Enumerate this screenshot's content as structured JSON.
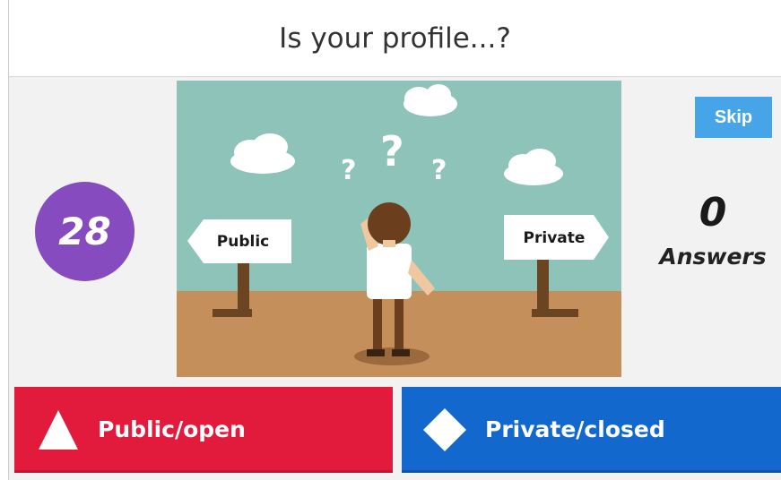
{
  "question": {
    "title": "Is your profile...?"
  },
  "timer": {
    "value": "28"
  },
  "skip": {
    "label": "Skip"
  },
  "answers": {
    "count": "0",
    "label": "Answers"
  },
  "image": {
    "sign_left": "Public",
    "sign_right": "Private"
  },
  "options": [
    {
      "label": "Public/open",
      "shape": "triangle-icon",
      "color": "#e21b3c"
    },
    {
      "label": "Private/closed",
      "shape": "diamond-icon",
      "color": "#1368ce"
    }
  ],
  "colors": {
    "timer": "#864cbf",
    "skip": "#46a4e8",
    "sky": "#8dc3b9",
    "ground": "#c48f5a"
  }
}
